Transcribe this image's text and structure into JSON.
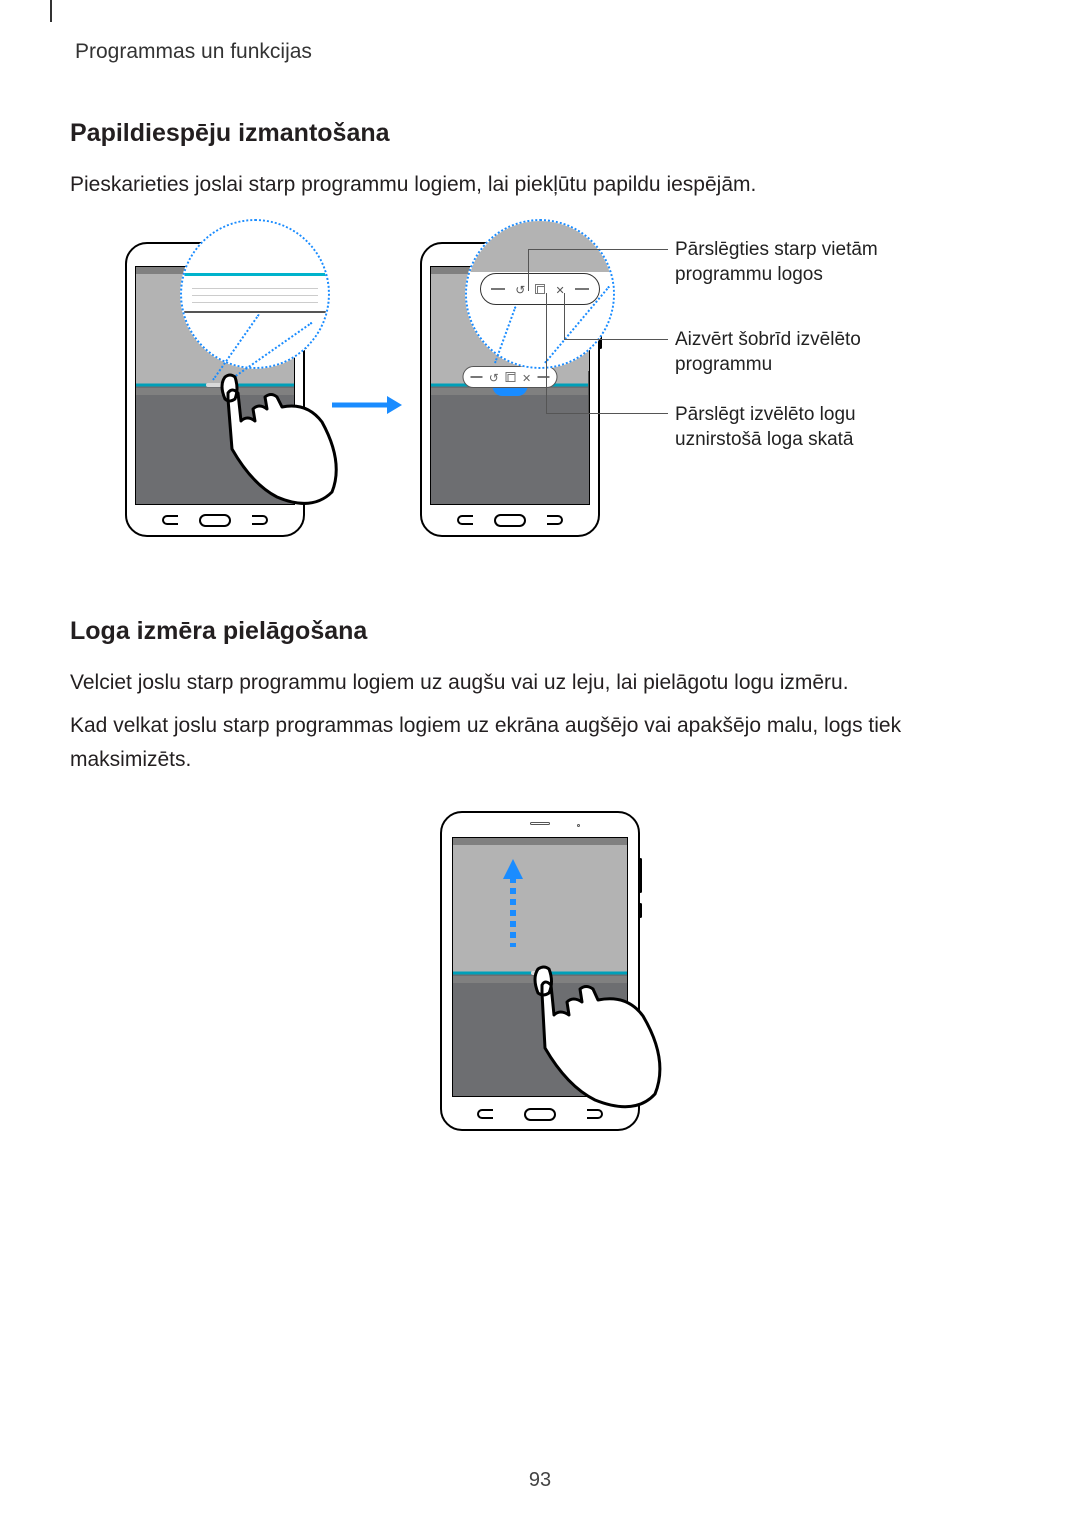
{
  "header": "Programmas un funkcijas",
  "section1": {
    "title": "Papildiespēju izmantošana",
    "p1": "Pieskarieties joslai starp programmu logiem, lai piekļūtu papildu iespējām."
  },
  "callouts": {
    "swap": "Pārslēgties starp vietām programmu logos",
    "close": "Aizvērt šobrīd izvēlēto programmu",
    "popup": "Pārslēgt izvēlēto logu uznirstošā loga skatā"
  },
  "section2": {
    "title": "Loga izmēra pielāgošana",
    "p1": "Velciet joslu starp programmu logiem uz augšu vai uz leju, lai pielāgotu logu izmēru.",
    "p2": "Kad velkat joslu starp programmas logiem uz ekrāna augšējo vai apakšējo malu, logs tiek maksimizēts."
  },
  "page_number": "93"
}
